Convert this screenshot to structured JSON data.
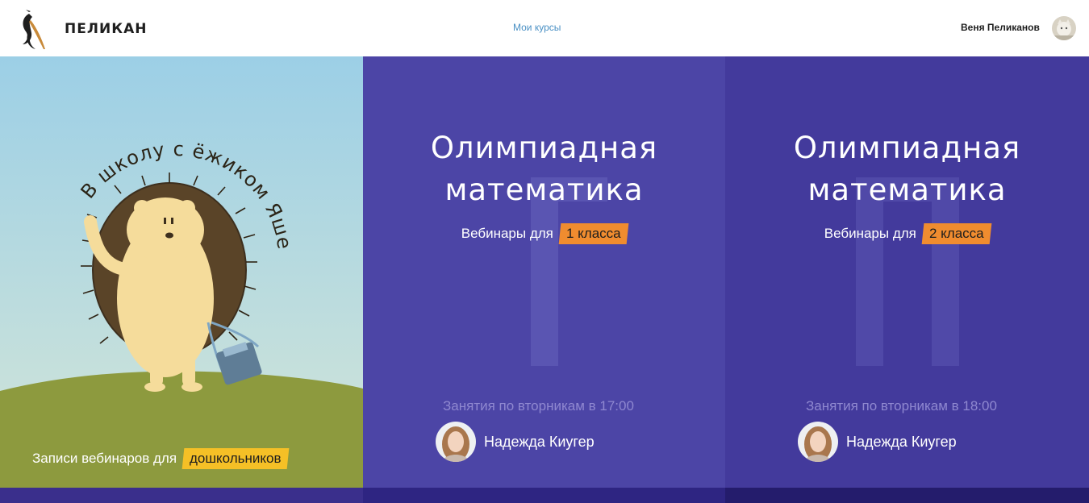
{
  "header": {
    "brand": "ПЕЛИКАН",
    "nav_my_courses": "Мои курсы",
    "user_name": "Веня Пеликанов"
  },
  "cards": [
    {
      "arc_text": "В школу с ёжиком Яшей",
      "caption_prefix": "Записи вебинаров для",
      "caption_badge": "дошкольников"
    },
    {
      "title_line1": "Олимпиадная",
      "title_line2": "математика",
      "sub_prefix": "Вебинары для",
      "sub_badge": "1 класса",
      "schedule": "Занятия по вторникам в 17:00",
      "teacher": "Надежда Киугер"
    },
    {
      "title_line1": "Олимпиадная",
      "title_line2": "математика",
      "sub_prefix": "Вебинары для",
      "sub_badge": "2 класса",
      "schedule": "Занятия по вторникам в 18:00",
      "teacher": "Надежда Киугер"
    }
  ],
  "colors": {
    "accent_link": "#4a90c4",
    "card_purple": "#4c45a6",
    "card_purple_dark": "#433a9c",
    "badge_orange": "#f08c2f",
    "badge_yellow": "#f5c026"
  },
  "icons": [
    "pelican-logo-icon",
    "user-avatar-icon",
    "teacher-avatar-icon"
  ]
}
